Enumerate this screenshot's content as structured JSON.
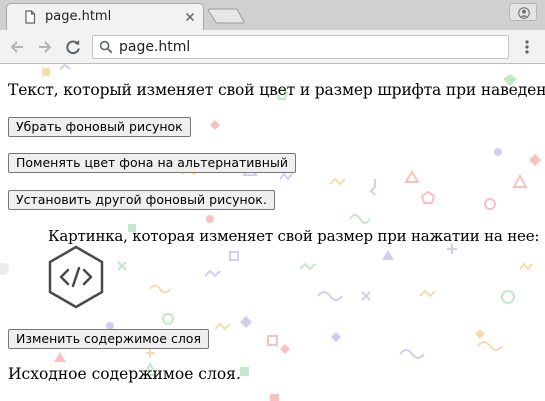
{
  "browser": {
    "tab": {
      "title": "page.html"
    },
    "address_bar": {
      "url": "page.html"
    }
  },
  "page": {
    "hover_text": "Текст, который изменяет свой цвет и размер шрифта при наведении на него.",
    "buttons": {
      "remove_background": "Убрать фоновый рисунок",
      "change_background_color": "Поменять цвет фона на альтернативный",
      "set_other_background": "Установить другой фоновый рисунок.",
      "change_layer_content": "Изменить содержимое слоя"
    },
    "image_caption": "Картинка, которая изменяет свой размер при нажатии на нее:",
    "image_icon": "code-hexagon-icon",
    "layer_text": "Исходное содержимое слоя."
  },
  "colors": {
    "pattern": [
      "#f7b7b7",
      "#b9e3c0",
      "#c9c6ea",
      "#f3d6a0",
      "#e0e0e0"
    ]
  }
}
